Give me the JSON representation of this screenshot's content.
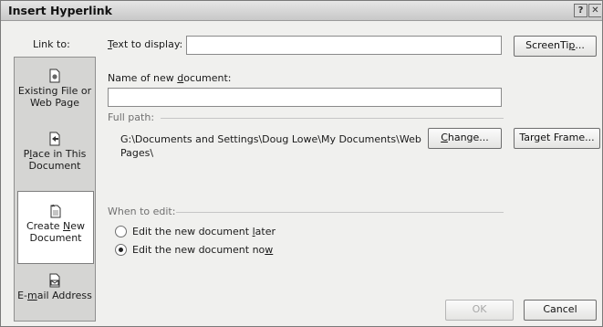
{
  "window": {
    "title": "Insert Hyperlink",
    "help_glyph": "?",
    "close_glyph": "✕"
  },
  "link_to": {
    "label": "Link to:",
    "items": [
      {
        "label_lines": [
          "Existing File or",
          "Web Page"
        ],
        "icon": "existing-file-icon",
        "selected": false
      },
      {
        "label_lines": [
          "Place in This",
          "Document"
        ],
        "icon": "place-in-document-icon",
        "selected": false
      },
      {
        "label_lines": [
          "Create New",
          "Document"
        ],
        "icon": "new-document-icon",
        "selected": true
      },
      {
        "label_lines": [
          "E-mail Address"
        ],
        "icon": "email-icon",
        "selected": false
      }
    ]
  },
  "text_to_display": {
    "label": "Text to display:",
    "value": ""
  },
  "screentip_button": "ScreenTip...",
  "new_document": {
    "label": "Name of new document:",
    "value": ""
  },
  "full_path": {
    "label": "Full path:",
    "line1": "G:\\Documents and Settings\\Doug Lowe\\My Documents\\Web",
    "line2": "Pages\\"
  },
  "change_button": "Change...",
  "target_frame_button": "Target Frame...",
  "when_to_edit": {
    "label": "When to edit:",
    "options": [
      {
        "label": "Edit the new document later",
        "checked": false
      },
      {
        "label": "Edit the new document now",
        "checked": true
      }
    ]
  },
  "ok_button": {
    "label": "OK",
    "enabled": false
  },
  "cancel_button": "Cancel"
}
